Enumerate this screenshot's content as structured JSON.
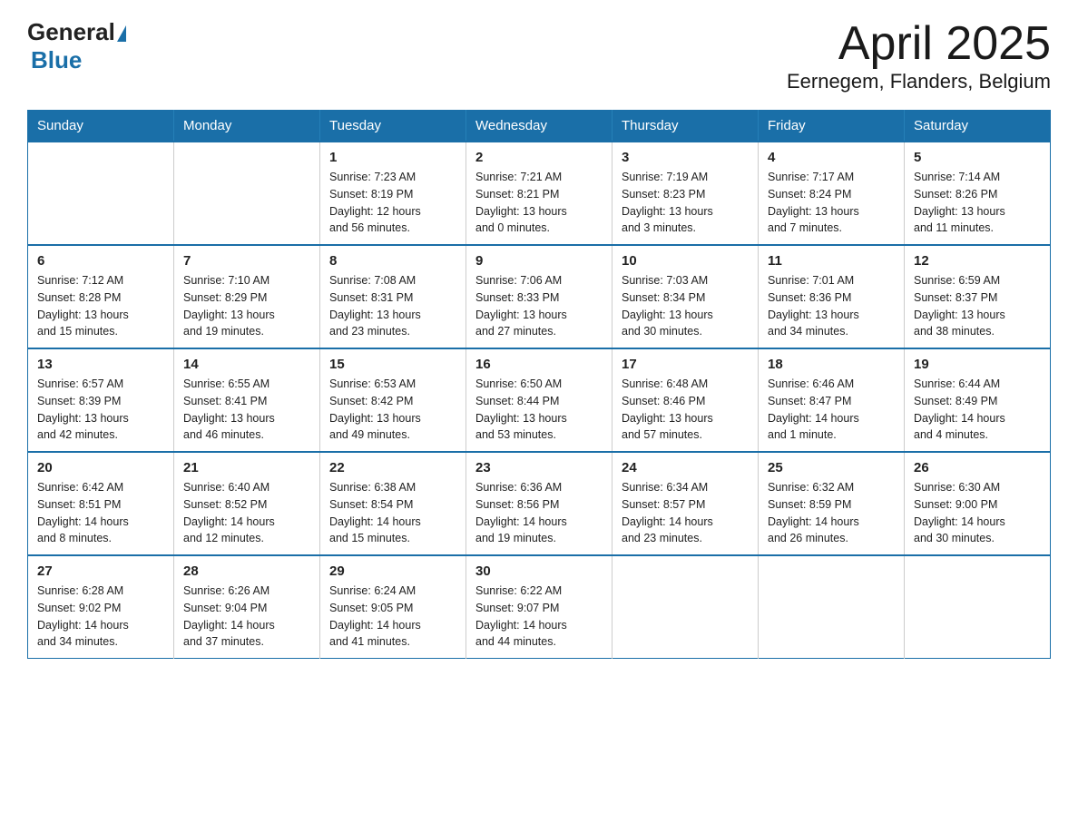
{
  "header": {
    "logo_general": "General",
    "logo_blue": "Blue",
    "title": "April 2025",
    "subtitle": "Eernegem, Flanders, Belgium"
  },
  "calendar": {
    "days_of_week": [
      "Sunday",
      "Monday",
      "Tuesday",
      "Wednesday",
      "Thursday",
      "Friday",
      "Saturday"
    ],
    "weeks": [
      [
        {
          "day": "",
          "info": ""
        },
        {
          "day": "",
          "info": ""
        },
        {
          "day": "1",
          "info": "Sunrise: 7:23 AM\nSunset: 8:19 PM\nDaylight: 12 hours\nand 56 minutes."
        },
        {
          "day": "2",
          "info": "Sunrise: 7:21 AM\nSunset: 8:21 PM\nDaylight: 13 hours\nand 0 minutes."
        },
        {
          "day": "3",
          "info": "Sunrise: 7:19 AM\nSunset: 8:23 PM\nDaylight: 13 hours\nand 3 minutes."
        },
        {
          "day": "4",
          "info": "Sunrise: 7:17 AM\nSunset: 8:24 PM\nDaylight: 13 hours\nand 7 minutes."
        },
        {
          "day": "5",
          "info": "Sunrise: 7:14 AM\nSunset: 8:26 PM\nDaylight: 13 hours\nand 11 minutes."
        }
      ],
      [
        {
          "day": "6",
          "info": "Sunrise: 7:12 AM\nSunset: 8:28 PM\nDaylight: 13 hours\nand 15 minutes."
        },
        {
          "day": "7",
          "info": "Sunrise: 7:10 AM\nSunset: 8:29 PM\nDaylight: 13 hours\nand 19 minutes."
        },
        {
          "day": "8",
          "info": "Sunrise: 7:08 AM\nSunset: 8:31 PM\nDaylight: 13 hours\nand 23 minutes."
        },
        {
          "day": "9",
          "info": "Sunrise: 7:06 AM\nSunset: 8:33 PM\nDaylight: 13 hours\nand 27 minutes."
        },
        {
          "day": "10",
          "info": "Sunrise: 7:03 AM\nSunset: 8:34 PM\nDaylight: 13 hours\nand 30 minutes."
        },
        {
          "day": "11",
          "info": "Sunrise: 7:01 AM\nSunset: 8:36 PM\nDaylight: 13 hours\nand 34 minutes."
        },
        {
          "day": "12",
          "info": "Sunrise: 6:59 AM\nSunset: 8:37 PM\nDaylight: 13 hours\nand 38 minutes."
        }
      ],
      [
        {
          "day": "13",
          "info": "Sunrise: 6:57 AM\nSunset: 8:39 PM\nDaylight: 13 hours\nand 42 minutes."
        },
        {
          "day": "14",
          "info": "Sunrise: 6:55 AM\nSunset: 8:41 PM\nDaylight: 13 hours\nand 46 minutes."
        },
        {
          "day": "15",
          "info": "Sunrise: 6:53 AM\nSunset: 8:42 PM\nDaylight: 13 hours\nand 49 minutes."
        },
        {
          "day": "16",
          "info": "Sunrise: 6:50 AM\nSunset: 8:44 PM\nDaylight: 13 hours\nand 53 minutes."
        },
        {
          "day": "17",
          "info": "Sunrise: 6:48 AM\nSunset: 8:46 PM\nDaylight: 13 hours\nand 57 minutes."
        },
        {
          "day": "18",
          "info": "Sunrise: 6:46 AM\nSunset: 8:47 PM\nDaylight: 14 hours\nand 1 minute."
        },
        {
          "day": "19",
          "info": "Sunrise: 6:44 AM\nSunset: 8:49 PM\nDaylight: 14 hours\nand 4 minutes."
        }
      ],
      [
        {
          "day": "20",
          "info": "Sunrise: 6:42 AM\nSunset: 8:51 PM\nDaylight: 14 hours\nand 8 minutes."
        },
        {
          "day": "21",
          "info": "Sunrise: 6:40 AM\nSunset: 8:52 PM\nDaylight: 14 hours\nand 12 minutes."
        },
        {
          "day": "22",
          "info": "Sunrise: 6:38 AM\nSunset: 8:54 PM\nDaylight: 14 hours\nand 15 minutes."
        },
        {
          "day": "23",
          "info": "Sunrise: 6:36 AM\nSunset: 8:56 PM\nDaylight: 14 hours\nand 19 minutes."
        },
        {
          "day": "24",
          "info": "Sunrise: 6:34 AM\nSunset: 8:57 PM\nDaylight: 14 hours\nand 23 minutes."
        },
        {
          "day": "25",
          "info": "Sunrise: 6:32 AM\nSunset: 8:59 PM\nDaylight: 14 hours\nand 26 minutes."
        },
        {
          "day": "26",
          "info": "Sunrise: 6:30 AM\nSunset: 9:00 PM\nDaylight: 14 hours\nand 30 minutes."
        }
      ],
      [
        {
          "day": "27",
          "info": "Sunrise: 6:28 AM\nSunset: 9:02 PM\nDaylight: 14 hours\nand 34 minutes."
        },
        {
          "day": "28",
          "info": "Sunrise: 6:26 AM\nSunset: 9:04 PM\nDaylight: 14 hours\nand 37 minutes."
        },
        {
          "day": "29",
          "info": "Sunrise: 6:24 AM\nSunset: 9:05 PM\nDaylight: 14 hours\nand 41 minutes."
        },
        {
          "day": "30",
          "info": "Sunrise: 6:22 AM\nSunset: 9:07 PM\nDaylight: 14 hours\nand 44 minutes."
        },
        {
          "day": "",
          "info": ""
        },
        {
          "day": "",
          "info": ""
        },
        {
          "day": "",
          "info": ""
        }
      ]
    ]
  }
}
